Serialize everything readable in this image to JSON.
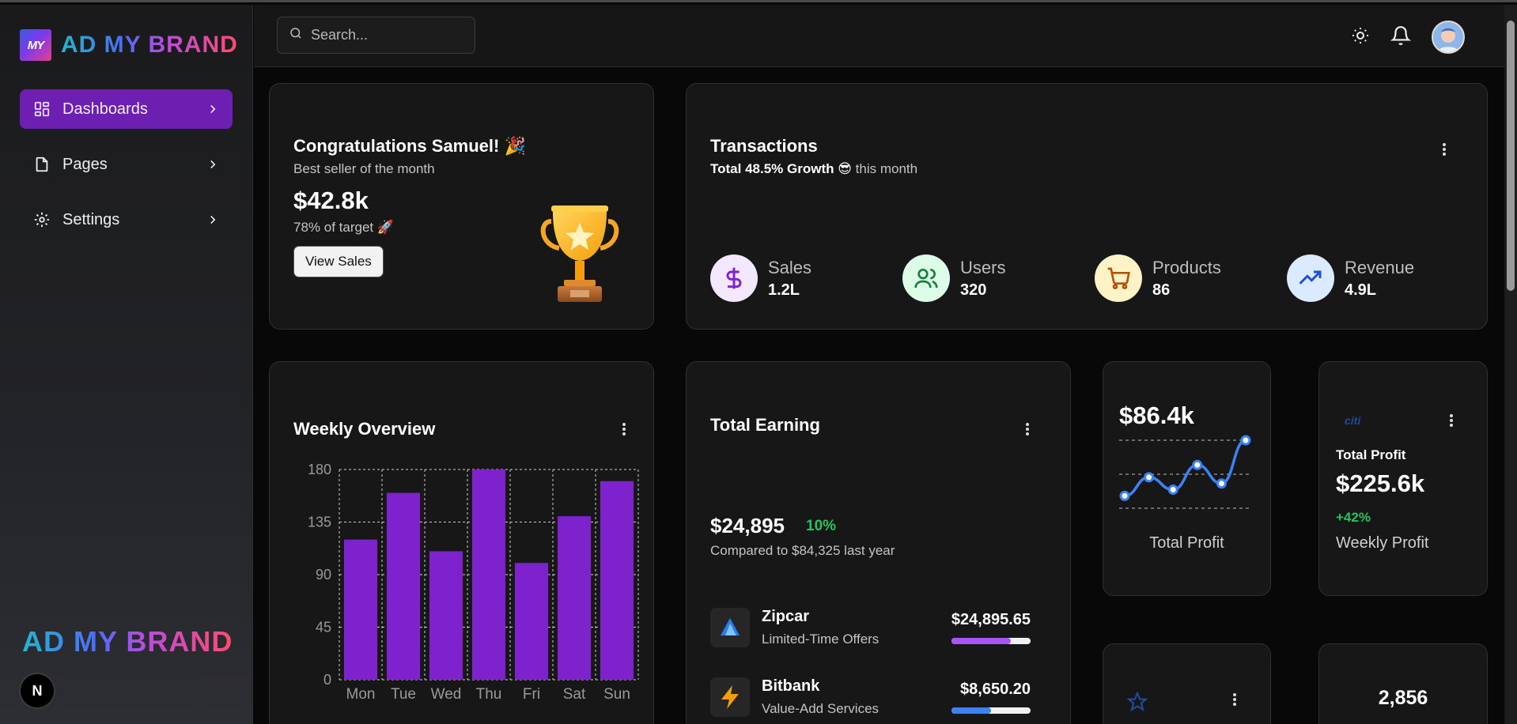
{
  "sidebar": {
    "brand": "AD MY BRAND",
    "brand_badge": "MY",
    "items": [
      {
        "label": "Dashboards",
        "icon": "dashboard-icon",
        "active": true
      },
      {
        "label": "Pages",
        "icon": "file-icon",
        "active": false
      },
      {
        "label": "Settings",
        "icon": "gear-icon",
        "active": false
      }
    ],
    "footer_brand": "AD MY BRAND",
    "footer_badge": "N"
  },
  "header": {
    "search_placeholder": "Search...",
    "icons": [
      "sun-icon",
      "bell-icon",
      "avatar"
    ]
  },
  "congrats": {
    "title": "Congratulations Samuel! 🎉",
    "subtitle": "Best seller of the month",
    "amount": "$42.8k",
    "target": "78% of target 🚀",
    "button": "View Sales"
  },
  "transactions": {
    "title": "Transactions",
    "growth_bold": "Total 48.5% Growth 😎",
    "growth_rest": " this month",
    "stats": [
      {
        "label": "Sales",
        "value": "1.2L",
        "icon": "dollar-icon",
        "bg": "#f3e8ff",
        "fg": "#7e22ce"
      },
      {
        "label": "Users",
        "value": "320",
        "icon": "users-icon",
        "bg": "#dcfce7",
        "fg": "#15803d"
      },
      {
        "label": "Products",
        "value": "86",
        "icon": "cart-icon",
        "bg": "#fef3c7",
        "fg": "#b45309"
      },
      {
        "label": "Revenue",
        "value": "4.9L",
        "icon": "trend-up-icon",
        "bg": "#dbeafe",
        "fg": "#1d4ed8"
      }
    ]
  },
  "weekly": {
    "title": "Weekly Overview"
  },
  "earning": {
    "title": "Total Earning",
    "amount": "$24,895",
    "percent": "10%",
    "compare": "Compared to $84,325 last year",
    "rows": [
      {
        "name": "Zipcar",
        "sub": "Limited-Time Offers",
        "amount": "$24,895.65",
        "progress": 0.75,
        "color": "#a855f7",
        "icon": "zipcar-icon"
      },
      {
        "name": "Bitbank",
        "sub": "Value-Add Services",
        "amount": "$8,650.20",
        "progress": 0.5,
        "color": "#3b82f6",
        "icon": "bolt-icon"
      }
    ]
  },
  "profit_card": {
    "value": "$86.4k",
    "label": "Total Profit",
    "line": [
      2,
      5,
      3,
      7,
      4,
      11
    ]
  },
  "weekly_profit": {
    "logo": "citi",
    "title": "Total Profit",
    "value": "$225.6k",
    "growth": "+42%",
    "label": "Weekly Profit"
  },
  "bottom_card": {
    "value": "2,856"
  },
  "chart_data": {
    "type": "bar",
    "categories": [
      "Mon",
      "Tue",
      "Wed",
      "Thu",
      "Fri",
      "Sat",
      "Sun"
    ],
    "values": [
      120,
      160,
      110,
      180,
      100,
      140,
      170
    ],
    "ylim": [
      0,
      180
    ],
    "yticks": [
      0,
      45,
      90,
      135,
      180
    ],
    "grid": true,
    "color": "#7e22ce"
  }
}
